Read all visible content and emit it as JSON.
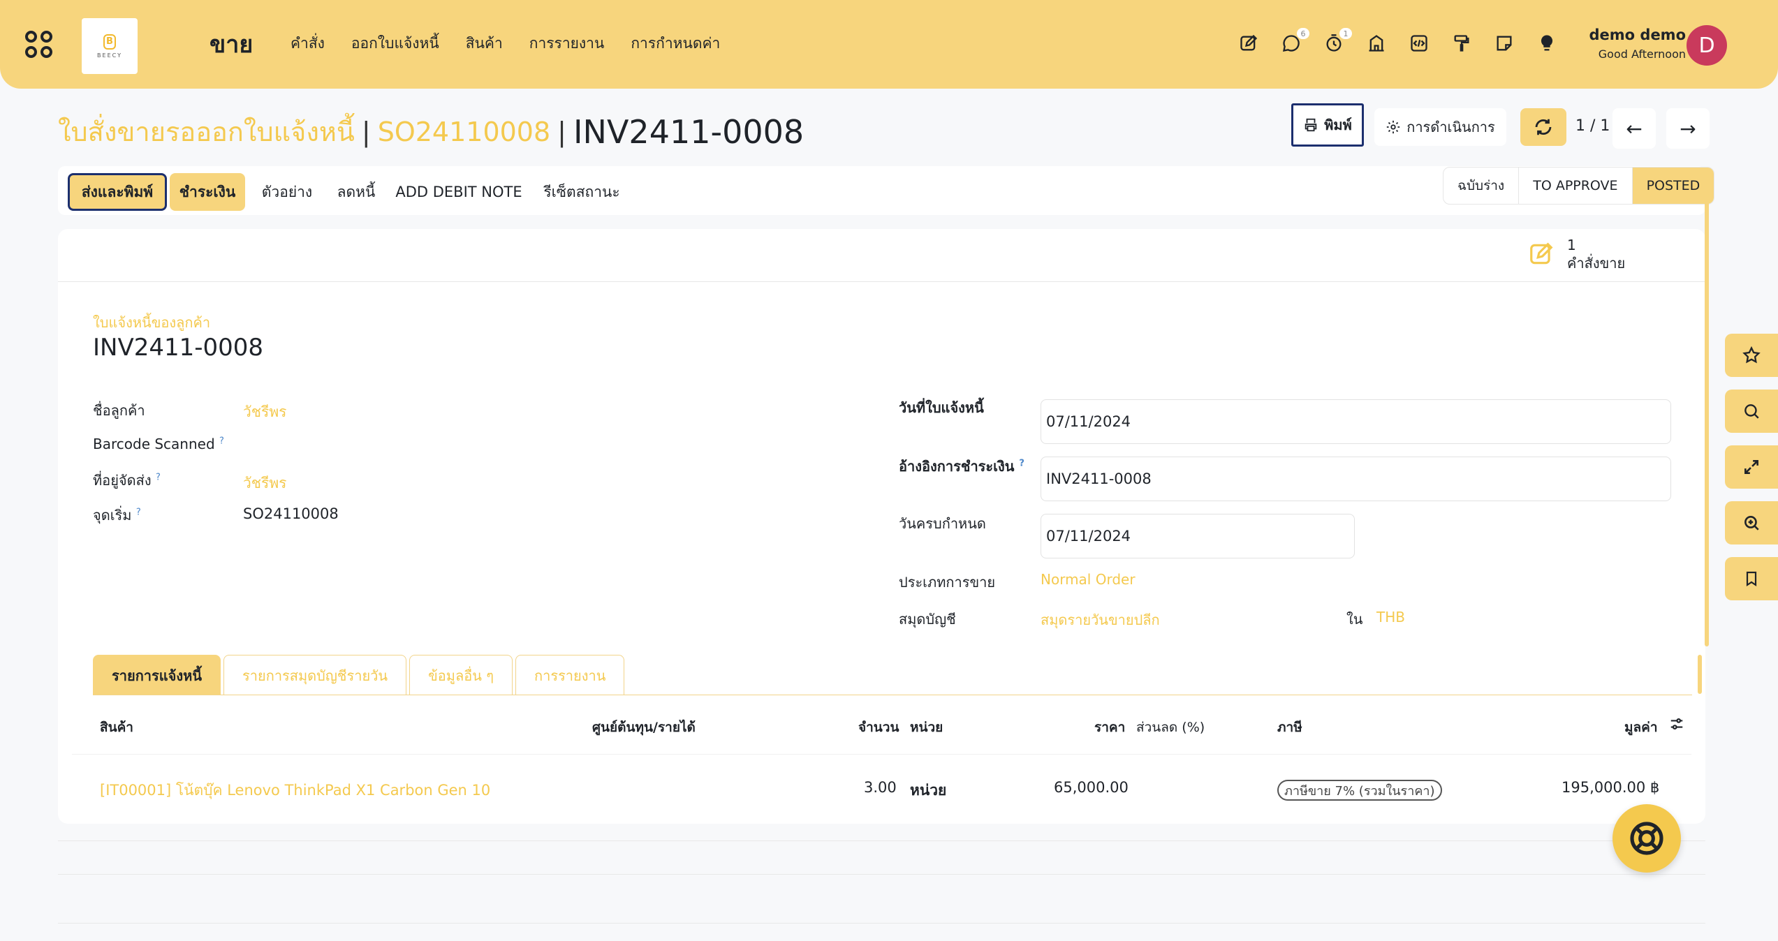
{
  "navbar": {
    "app_title": "ขาย",
    "logo_text": "BEECY",
    "menu": [
      "คำสั่ง",
      "ออกใบแจ้งหนี้",
      "สินค้า",
      "การรายงาน",
      "การกำหนดค่า"
    ],
    "chat_badge": "6",
    "activity_badge": "1",
    "user_name": "demo demo",
    "greeting": "Good Afternoon",
    "avatar_letter": "D"
  },
  "breadcrumb": {
    "parent": "ใบสั่งขายรอออกใบแจ้งหนี้",
    "order": "SO24110008",
    "current": "INV2411-0008",
    "separator": "|"
  },
  "control": {
    "print_label": "พิมพ์",
    "action_label": "การดำเนินการ",
    "pager": "1 / 1",
    "prev": "←",
    "next": "→"
  },
  "actionbar": {
    "send_print": "ส่งและพิมพ์",
    "pay": "ชำระเงิน",
    "preview": "ตัวอย่าง",
    "credit_note": "ลดหนี้",
    "debit_note": "ADD DEBIT NOTE",
    "reset": "รีเซ็ตสถานะ"
  },
  "status": [
    "ฉบับร่าง",
    "TO APPROVE",
    "POSTED"
  ],
  "smart_button": {
    "count": "1",
    "label": "คำสั่งขาย"
  },
  "document": {
    "type_label": "ใบแจ้งหนี้ของลูกค้า",
    "number": "INV2411-0008"
  },
  "left_fields": {
    "customer_label": "ชื่อลูกค้า",
    "customer_value": "วัชรีพร",
    "barcode_label": "Barcode Scanned",
    "delivery_label": "ที่อยู่จัดส่ง",
    "delivery_value": "วัชรีพร",
    "origin_label": "จุดเริ่ม",
    "origin_value": "SO24110008",
    "help_mark": "?"
  },
  "right_fields": {
    "invoice_date_label": "วันที่ใบแจ้งหนี้",
    "invoice_date_value": "07/11/2024",
    "payment_ref_label": "อ้างอิงการชำระเงิน",
    "payment_ref_value": "INV2411-0008",
    "due_date_label": "วันครบกำหนด",
    "due_date_value": "07/11/2024",
    "sale_type_label": "ประเภทการขาย",
    "sale_type_value": "Normal Order",
    "journal_label": "สมุดบัญชี",
    "journal_value": "สมุดรายวันขายปลีก",
    "in_label": "ใน",
    "currency": "THB"
  },
  "tabs": [
    "รายการแจ้งหนี้",
    "รายการสมุดบัญชีรายวัน",
    "ข้อมูลอื่น ๆ",
    "การรายงาน"
  ],
  "table": {
    "headers": {
      "product": "สินค้า",
      "cost_center": "ศูนย์ต้นทุน/รายได้",
      "qty": "จำนวน",
      "uom": "หน่วย",
      "price": "ราคา",
      "discount": "ส่วนลด (%)",
      "tax": "ภาษี",
      "amount": "มูลค่า"
    },
    "rows": [
      {
        "product": "[IT00001] โน้ตบุ๊ค Lenovo ThinkPad X1 Carbon Gen 10",
        "qty": "3.00",
        "uom": "หน่วย",
        "price": "65,000.00",
        "tax": "ภาษีขาย 7% (รวมในราคา)",
        "amount": "195,000.00 ฿"
      }
    ]
  },
  "colors": {
    "accent": "#f7d57d",
    "link": "#f4c94e",
    "focus": "#1c2f6e",
    "avatar": "#c93a5c"
  }
}
